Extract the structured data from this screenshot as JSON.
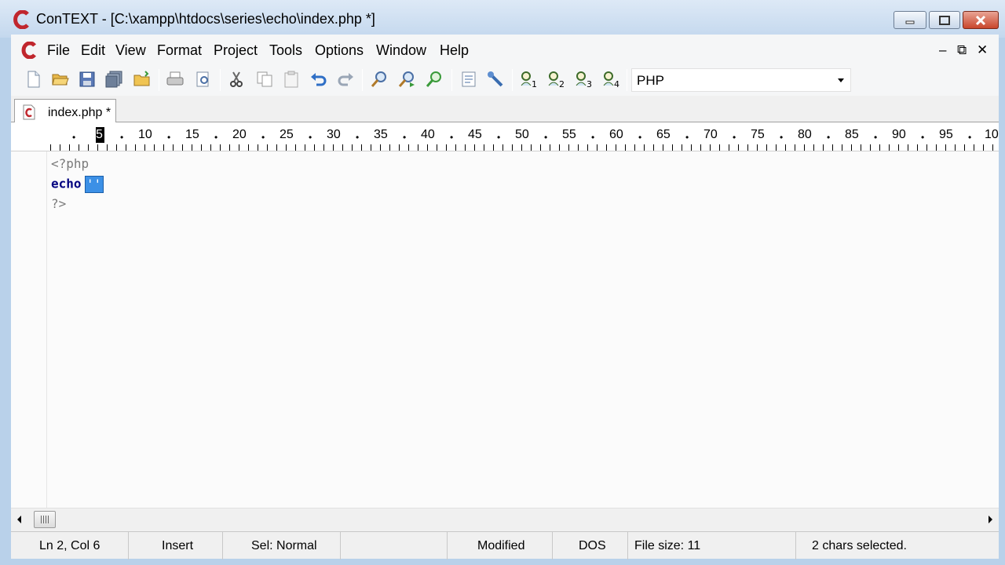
{
  "window": {
    "title": "ConTEXT - [C:\\xampp\\htdocs\\series\\echo\\index.php *]"
  },
  "menu": {
    "items": [
      "File",
      "Edit",
      "View",
      "Format",
      "Project",
      "Tools",
      "Options",
      "Window",
      "Help"
    ]
  },
  "toolbar": {
    "highlighter": "PHP",
    "icons": [
      "new-file-icon",
      "open-folder-icon",
      "save-icon",
      "save-all-icon",
      "open-project-icon",
      "print-icon",
      "print-preview-icon",
      "cut-icon",
      "copy-icon",
      "paste-icon",
      "undo-icon",
      "redo-icon",
      "find-icon",
      "find-next-icon",
      "replace-icon",
      "file-properties-icon",
      "user-settings-icon",
      "user-command-1-icon",
      "user-command-2-icon",
      "user-command-3-icon",
      "user-command-4-icon"
    ]
  },
  "tabs": [
    {
      "label": "index.php *",
      "active": true
    }
  ],
  "ruler": {
    "current_column_marker": "5",
    "labels": [
      "10",
      "15",
      "20",
      "25",
      "30",
      "35",
      "40",
      "45",
      "50",
      "55",
      "60",
      "65",
      "70",
      "75",
      "80",
      "85",
      "90",
      "95",
      "10"
    ]
  },
  "editor": {
    "line1": "<?php",
    "line2_keyword": "echo",
    "line2_selected": "''",
    "line3": "?>"
  },
  "statusbar": {
    "position": "Ln 2, Col 6",
    "mode": "Insert",
    "selection_mode": "Sel: Normal",
    "modified": "Modified",
    "line_endings": "DOS",
    "file_size": "File size: 11",
    "selection_info": "2 chars selected."
  },
  "colors": {
    "title_bar": "#c4d8ee",
    "selection": "#3c90e6",
    "keyword": "#00007f",
    "close_button": "#c9462c"
  }
}
